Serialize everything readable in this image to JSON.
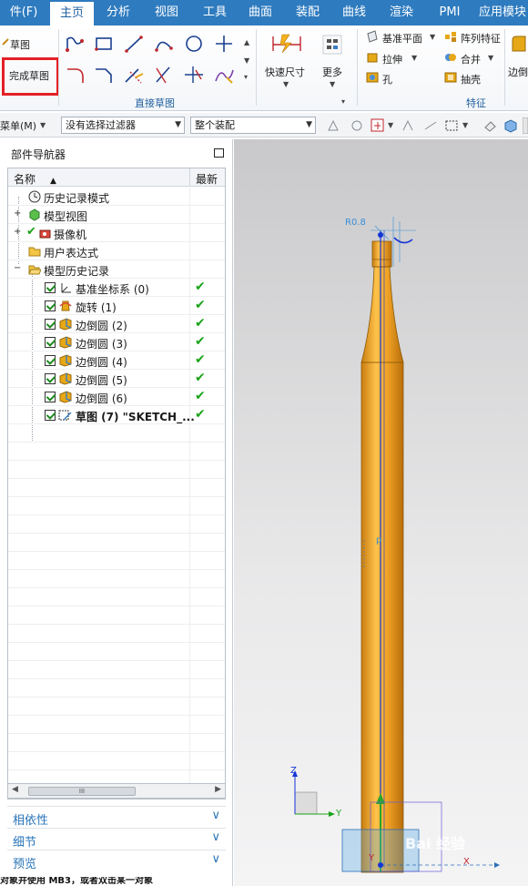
{
  "menu_tabs": [
    {
      "label": "件(F)"
    },
    {
      "label": "主页"
    },
    {
      "label": "分析"
    },
    {
      "label": "视图"
    },
    {
      "label": "工具"
    },
    {
      "label": "曲面"
    },
    {
      "label": "装配"
    },
    {
      "label": "曲线"
    },
    {
      "label": "渲染"
    },
    {
      "label": "PMI"
    },
    {
      "label": "应用模块"
    }
  ],
  "ribbon": {
    "sketch_label": "草图",
    "finish_sketch_label": "完成草图",
    "direct_sketch_group": "直接草图",
    "rapid_dimension_label": "快速尺寸",
    "more_label": "更多",
    "datum_plane_label": "基准平面",
    "pattern_feature_label": "阵列特征",
    "extrude_label": "拉伸",
    "unite_label": "合并",
    "hole_label": "孔",
    "shell_label": "抽壳",
    "edge_blend_label": "边倒",
    "feature_group": "特征"
  },
  "toolbar": {
    "menu_label": "菜单(M)",
    "filter_value": "没有选择过滤器",
    "scope_value": "整个装配"
  },
  "navigator": {
    "title": "部件导航器",
    "col_name": "名称",
    "col_latest": "最新",
    "items": [
      {
        "label": "历史记录模式",
        "icon": "clock-icon"
      },
      {
        "label": "模型视图",
        "icon": "model-view-icon"
      },
      {
        "label": "摄像机",
        "icon": "camera-icon"
      },
      {
        "label": "用户表达式",
        "icon": "folder-icon"
      },
      {
        "label": "模型历史记录",
        "icon": "open-folder-icon"
      },
      {
        "label": "基准坐标系 (0)",
        "icon": "datum-csys-icon",
        "latest": "✔"
      },
      {
        "label": "旋转 (1)",
        "icon": "revolve-icon",
        "latest": "✔"
      },
      {
        "label": "边倒圆 (2)",
        "icon": "edge-blend-icon",
        "latest": "✔"
      },
      {
        "label": "边倒圆 (3)",
        "icon": "edge-blend-icon",
        "latest": "✔"
      },
      {
        "label": "边倒圆 (4)",
        "icon": "edge-blend-icon",
        "latest": "✔"
      },
      {
        "label": "边倒圆 (5)",
        "icon": "edge-blend-icon",
        "latest": "✔"
      },
      {
        "label": "边倒圆 (6)",
        "icon": "edge-blend-icon",
        "latest": "✔"
      },
      {
        "label": "草图 (7) \"SKETCH_...",
        "icon": "sketch-icon",
        "latest": "✔"
      }
    ],
    "hscroll_grip": "III",
    "panels": [
      {
        "label": "相依性"
      },
      {
        "label": "细节"
      },
      {
        "label": "预览"
      }
    ]
  },
  "viewport": {
    "dimension_label": "R0.8",
    "dimension_label_2": "p",
    "axis_x": "X",
    "axis_y": "Y",
    "axis_z": "Z",
    "watermark": "Bai 经验"
  },
  "status": {
    "text": "对象并使用 MB3，或者双击某一对象"
  },
  "colors": {
    "accent": "#2e7bbf",
    "part": "#f0a020",
    "highlight_box": "#e52027",
    "check": "#1aa31a"
  }
}
